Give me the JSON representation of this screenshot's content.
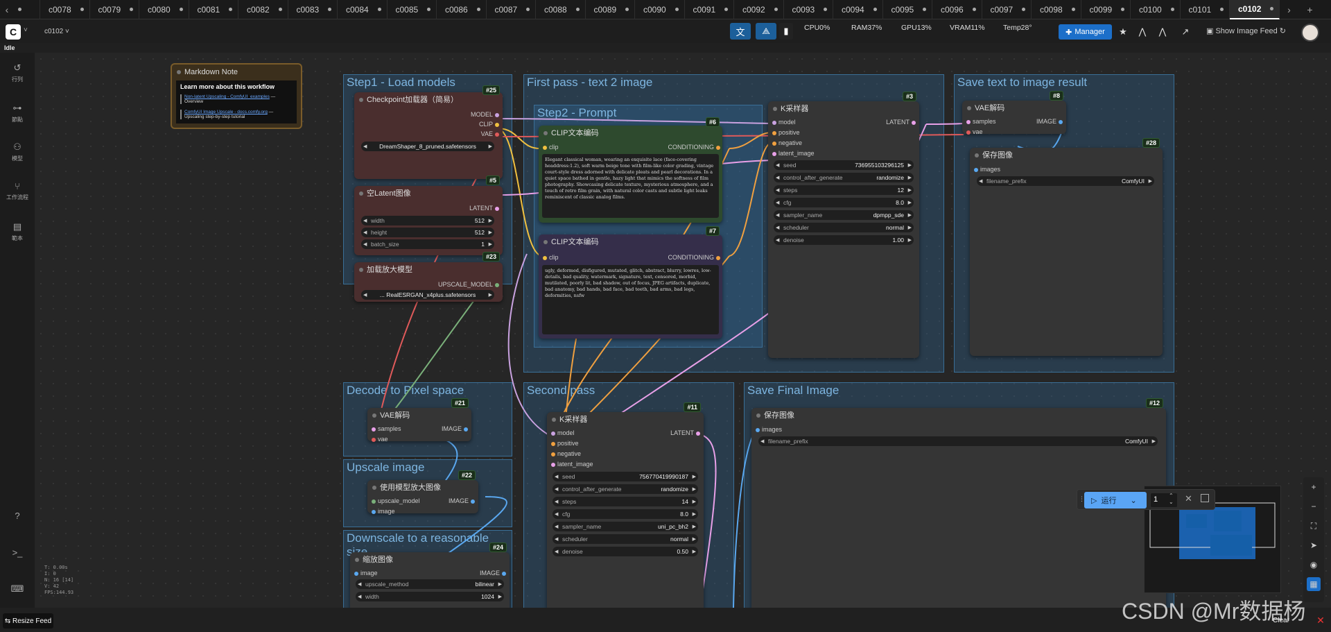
{
  "tabs": [
    "c0078",
    "c0079",
    "c0080",
    "c0081",
    "c0082",
    "c0083",
    "c0084",
    "c0085",
    "c0086",
    "c0087",
    "c0088",
    "c0089",
    "c0090",
    "c0091",
    "c0092",
    "c0093",
    "c0094",
    "c0095",
    "c0096",
    "c0097",
    "c0098",
    "c0099",
    "c0100",
    "c0101",
    "c0102"
  ],
  "active_tab": "c0102",
  "workflow_name": "c0102 ˅",
  "status": "Idle",
  "stats": {
    "cpu": "CPU0%",
    "ram": "RAM37%",
    "gpu": "GPU13%",
    "vram": "VRAM11%",
    "temp": "Temp28°"
  },
  "manager_label": "Manager",
  "show_feed_label": "Show Image Feed",
  "sidebar": [
    {
      "label": "行列",
      "icon": "history-icon"
    },
    {
      "label": "節點",
      "icon": "node-icon"
    },
    {
      "label": "模型",
      "icon": "model-icon"
    },
    {
      "label": "工作流程",
      "icon": "workflow-icon"
    },
    {
      "label": "範本",
      "icon": "template-icon"
    }
  ],
  "groups": {
    "g1": "Step1 - Load models",
    "g2": "First pass - text 2 image",
    "g3": "Save text to image result",
    "g4": "Step2 - Prompt",
    "g5": "Decode to Pixel space",
    "g6": "Second pass",
    "g7": "Save Final Image",
    "g8": "Upscale image",
    "g9": "Downscale to a reasonable size"
  },
  "note": {
    "title": "Markdown Note",
    "heading": "Learn more about this workflow",
    "link1": "Non-latent Upscaling - ComfyUI_examples",
    "link1_suffix": "— Overview",
    "link2": "ComfyUI Image Upscale - docs.comfy.org",
    "link2_suffix": "— Upscaling step-by-step tutorial"
  },
  "nodes": {
    "ckpt": {
      "title": "Checkpoint加载器（简易）",
      "id": "#25",
      "out1": "MODEL",
      "out2": "CLIP",
      "out3": "VAE",
      "value": "DreamShaper_8_pruned.safetensors"
    },
    "latent": {
      "title": "空Latent图像",
      "id": "#5",
      "out": "LATENT",
      "w_label": "width",
      "w": "512",
      "h_label": "height",
      "h": "512",
      "b_label": "batch_size",
      "b": "1"
    },
    "upmodel": {
      "title": "加载放大模型",
      "id": "#23",
      "out": "UPSCALE_MODEL",
      "value": "... RealESRGAN_x4plus.safetensors"
    },
    "clip_pos": {
      "title": "CLIP文本编码",
      "id": "#6",
      "in": "clip",
      "out": "CONDITIONING",
      "text": "Elegant classical woman, wearing an exquisite lace (face-covering headdress:1.2), soft warm beige tone with film-like color grading, vintage court-style dress adorned with delicate pleats and pearl decorations. In a quiet space bathed in gentle, hazy light that mimics the softness of film photography. Showcasing delicate texture, mysterious atmosphere, and a touch of retro film grain, with natural color casts and subtle light leaks reminiscent of classic analog films."
    },
    "clip_neg": {
      "title": "CLIP文本编码",
      "id": "#7",
      "in": "clip",
      "out": "CONDITIONING",
      "text": "ugly, deformed, disfigured, mutated, glitch, abstract, blurry, lowres, low-details, bad quality, watermark, signature, text, censored, morbid, mutilated, poorly lit, bad shadow, out of focus, JPEG artifacts, duplicate, bad anatomy, bad hands, bad face, bad teeth, bad arms, bad legs, deformities, nsfw"
    },
    "ks1": {
      "title": "K采样器",
      "id": "#3",
      "in1": "model",
      "in2": "positive",
      "in3": "negative",
      "in4": "latent_image",
      "out": "LATENT",
      "seed_l": "seed",
      "seed": "736955103296125",
      "cag_l": "control_after_generate",
      "cag": "randomize",
      "steps_l": "steps",
      "steps": "12",
      "cfg_l": "cfg",
      "cfg": "8.0",
      "sampler_l": "sampler_name",
      "sampler": "dpmpp_sde",
      "sched_l": "scheduler",
      "sched": "normal",
      "den_l": "denoise",
      "den": "1.00"
    },
    "vae1": {
      "title": "VAE解码",
      "id": "#8",
      "in1": "samples",
      "in2": "vae",
      "out": "IMAGE"
    },
    "save1": {
      "title": "保存图像",
      "id": "#28",
      "in": "images",
      "w_label": "filename_prefix",
      "w": "ComfyUI"
    },
    "vae2": {
      "title": "VAE解码",
      "id": "#21",
      "in1": "samples",
      "in2": "vae",
      "out": "IMAGE"
    },
    "ks2": {
      "title": "K采样器",
      "id": "#11",
      "in1": "model",
      "in2": "positive",
      "in3": "negative",
      "in4": "latent_image",
      "out": "LATENT",
      "seed_l": "seed",
      "seed": "756770419990187",
      "cag_l": "control_after_generate",
      "cag": "randomize",
      "steps_l": "steps",
      "steps": "14",
      "cfg_l": "cfg",
      "cfg": "8.0",
      "sampler_l": "sampler_name",
      "sampler": "uni_pc_bh2",
      "sched_l": "scheduler",
      "sched": "normal",
      "den_l": "denoise",
      "den": "0.50"
    },
    "save2": {
      "title": "保存图像",
      "id": "#12",
      "in": "images",
      "w_label": "filename_prefix",
      "w": "ComfyUI"
    },
    "upscale": {
      "title": "使用模型放大图像",
      "id": "#22",
      "in1": "upscale_model",
      "in2": "image",
      "out": "IMAGE"
    },
    "scale": {
      "title": "缩放图像",
      "id": "#24",
      "in": "image",
      "out": "IMAGE",
      "m_label": "upscale_method",
      "m": "bilinear",
      "w_label": "width",
      "w": "1024"
    }
  },
  "run": {
    "label": "运行",
    "count": "1"
  },
  "debug": [
    "T: 0.00s",
    "I: 0",
    "N: 16 [14]",
    "V: 42",
    "FPS:144.93"
  ],
  "resize_feed": "Resize Feed",
  "clear": "Clear",
  "watermark": "CSDN @Mr数据杨"
}
